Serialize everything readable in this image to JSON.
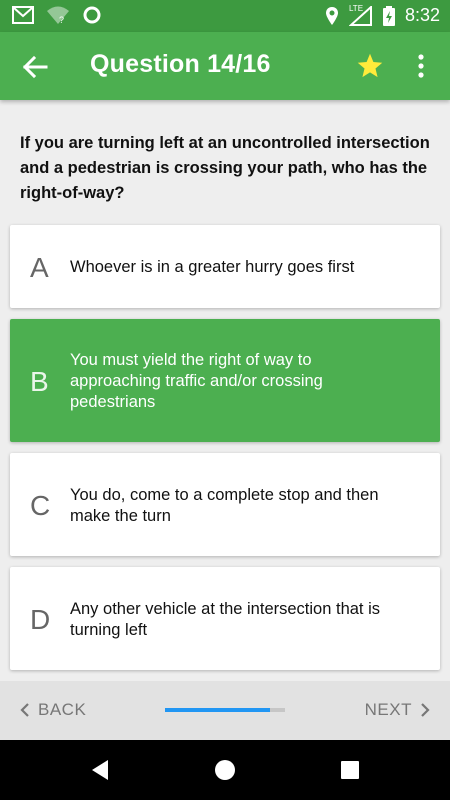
{
  "status_bar": {
    "time": "8:32",
    "network_label": "LTE",
    "icons": [
      "gmail-icon",
      "wifi-question-icon",
      "circle-icon",
      "location-icon",
      "signal-icon",
      "battery-icon"
    ]
  },
  "app_bar": {
    "title": "Question 14/16",
    "back_icon": "arrow-left-icon",
    "favorite_icon": "star-icon",
    "menu_icon": "more-vert-icon"
  },
  "question": {
    "text": "If you are turning left at an uncontrolled intersection and a pedestrian is crossing your path, who has the right-of-way?"
  },
  "answers": [
    {
      "letter": "A",
      "text": "Whoever is in a greater hurry goes first",
      "selected": false
    },
    {
      "letter": "B",
      "text": "You must yield the right of way to approaching traffic and/or crossing pedestrians",
      "selected": true
    },
    {
      "letter": "C",
      "text": "You do, come to a complete stop and then make the turn",
      "selected": false
    },
    {
      "letter": "D",
      "text": "Any other vehicle at the intersection that is turning left",
      "selected": false
    }
  ],
  "bottom_bar": {
    "back_label": "BACK",
    "next_label": "NEXT",
    "progress_fraction": 0.875
  },
  "colors": {
    "status_bar": "#3d9a40",
    "app_bar": "#4caf50",
    "selected_answer": "#4caf50",
    "star": "#ffeb3b",
    "progress": "#2196f3"
  }
}
